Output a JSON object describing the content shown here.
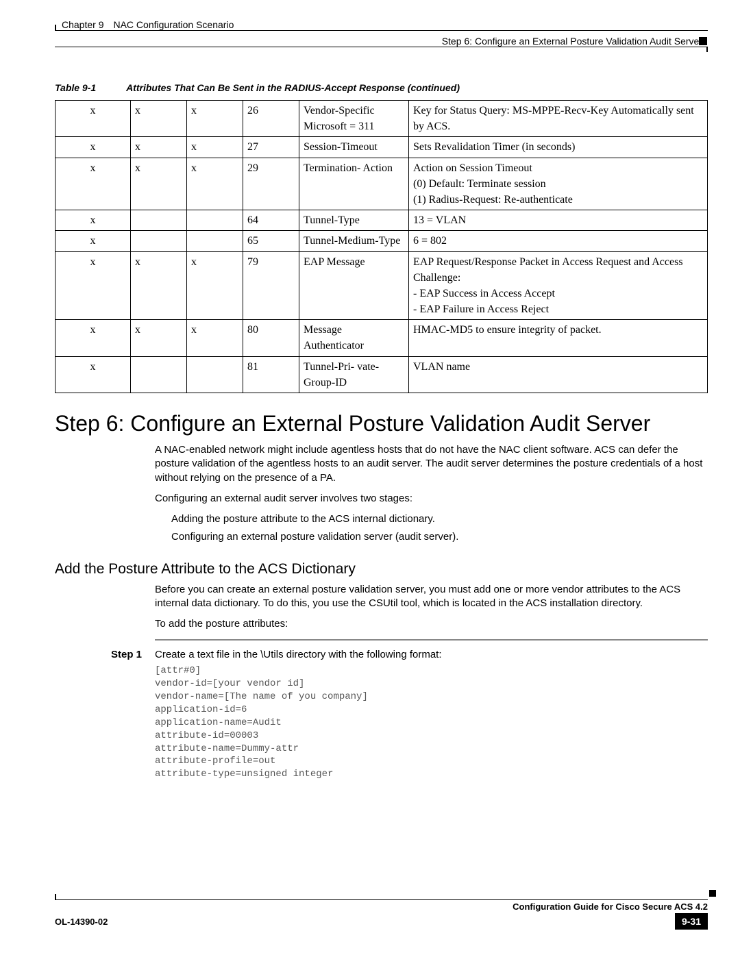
{
  "header": {
    "chapter": "Chapter 9 NAC Configuration Scenario",
    "section": "Step 6: Configure an External Posture Validation Audit Server"
  },
  "table": {
    "number": "Table 9-1",
    "caption": "Attributes That Can Be Sent in the RADIUS-Accept Response (continued)",
    "rows": [
      {
        "c1": "x",
        "c2": "x",
        "c3": "x",
        "c4": "26",
        "c5": "Vendor-Specific Microsoft = 311",
        "c6": "Key for Status Query: MS-MPPE-Recv-Key Automatically sent by ACS."
      },
      {
        "c1": "x",
        "c2": "x",
        "c3": "x",
        "c4": "27",
        "c5": "Session-Timeout",
        "c6": "Sets Revalidation Timer (in seconds)"
      },
      {
        "c1": "x",
        "c2": "x",
        "c3": "x",
        "c4": "29",
        "c5": "Termination- Action",
        "c6": "Action on Session Timeout\n(0) Default: Terminate session\n(1) Radius-Request: Re-authenticate"
      },
      {
        "c1": "x",
        "c2": "",
        "c3": "",
        "c4": "64",
        "c5": "Tunnel-Type",
        "c6": "13 = VLAN"
      },
      {
        "c1": "x",
        "c2": "",
        "c3": "",
        "c4": "65",
        "c5": "Tunnel-Medium-Type",
        "c6": "6 = 802"
      },
      {
        "c1": "x",
        "c2": "x",
        "c3": "x",
        "c4": "79",
        "c5": "EAP Message",
        "c6": "EAP Request/Response Packet in Access Request and Access Challenge:\n- EAP Success in Access Accept\n- EAP Failure in Access Reject"
      },
      {
        "c1": "x",
        "c2": "x",
        "c3": "x",
        "c4": "80",
        "c5": "Message Authenticator",
        "c6": "HMAC-MD5 to ensure integrity of packet."
      },
      {
        "c1": "x",
        "c2": "",
        "c3": "",
        "c4": "81",
        "c5": "Tunnel-Pri- vate-Group-ID",
        "c6": "VLAN name"
      }
    ]
  },
  "main": {
    "heading": "Step 6: Configure an External Posture Validation Audit Server",
    "para1": "A NAC-enabled network might include agentless hosts that do not have the NAC client software. ACS can defer the posture validation of the agentless hosts to an audit server. The audit server determines the posture credentials of a host without relying on the presence of a PA.",
    "para2": "Configuring an external audit server involves two stages:",
    "bullet1": "Adding the posture attribute to the ACS internal dictionary.",
    "bullet2": "Configuring an external posture validation server (audit server).",
    "subheading": "Add the Posture Attribute to the ACS Dictionary",
    "para3": "Before you can create an external posture validation server, you must add one or more vendor attributes to the ACS internal data dictionary. To do this, you use the CSUtil tool, which is located in the ACS installation directory.",
    "para4": "To add the posture attributes:",
    "step1_label": "Step 1",
    "step1_text": "Create a text file in the \\Utils directory with the following format:",
    "code": "[attr#0]\nvendor-id=[your vendor id]\nvendor-name=[The name of you company]\napplication-id=6\napplication-name=Audit\nattribute-id=00003\nattribute-name=Dummy-attr\nattribute-profile=out\nattribute-type=unsigned integer"
  },
  "footer": {
    "guide": "Configuration Guide for Cisco Secure ACS 4.2",
    "doc": "OL-14390-02",
    "page": "9-31"
  }
}
